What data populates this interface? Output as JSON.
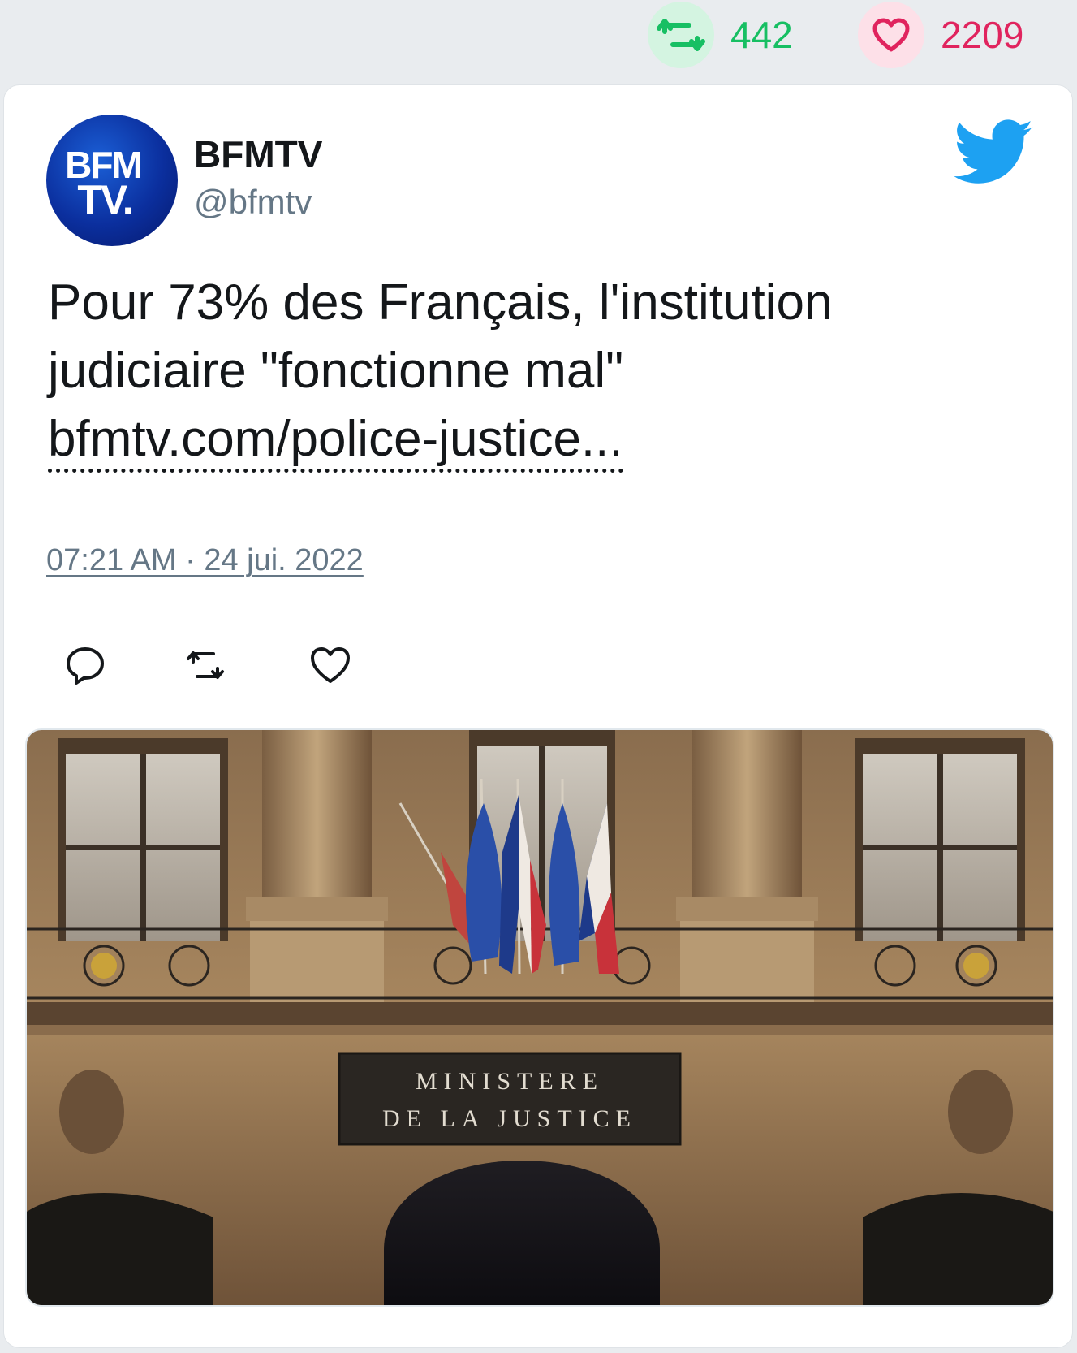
{
  "stats": {
    "retweets": "442",
    "likes": "2209",
    "retweet_icon": "retweet-icon",
    "like_icon": "heart-icon"
  },
  "tweet": {
    "author_name": "BFMTV",
    "author_handle": "@bfmtv",
    "avatar_logo_line1": "BFM",
    "avatar_logo_line2": "TV.",
    "text_line1": "Pour 73% des Français, l'institution",
    "text_line2": "judiciaire \"fonctionne mal\"",
    "link": "bfmtv.com/police-justice...",
    "timestamp": "07:21 AM · 24 jui. 2022"
  },
  "media": {
    "sign_line1": "MINISTERE",
    "sign_line2": "DE LA JUSTICE"
  },
  "colors": {
    "retweet_green": "#17bf63",
    "like_red": "#e0245e",
    "twitter_blue": "#1da1f2",
    "text_dark": "#14171a",
    "text_gray": "#657786"
  }
}
